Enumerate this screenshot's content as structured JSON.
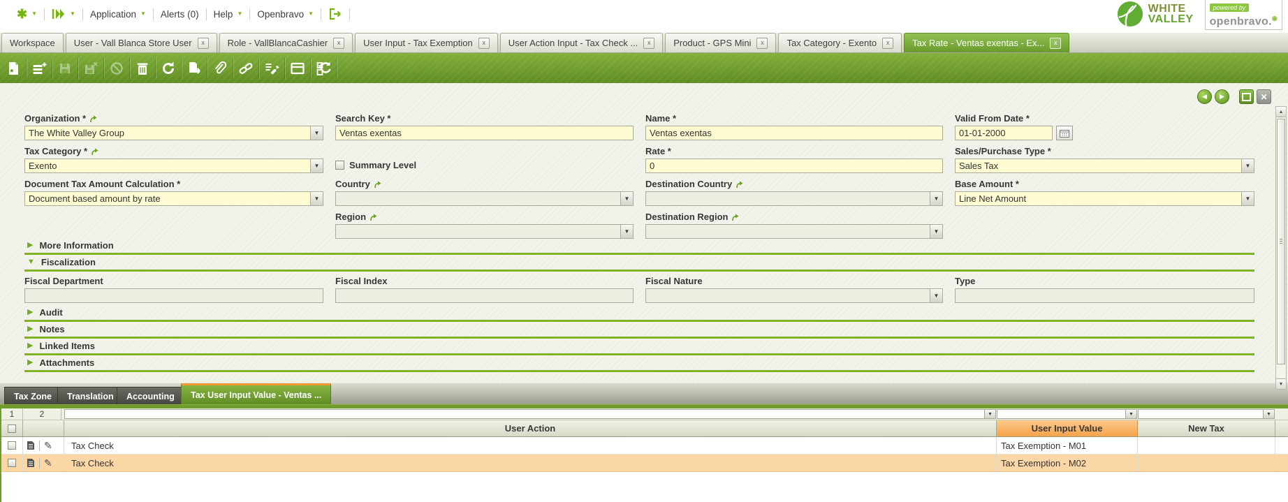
{
  "menubar": {
    "application": "Application",
    "alerts": "Alerts (0)",
    "help": "Help",
    "openbravo": "Openbravo"
  },
  "logo": {
    "line1": "WHITE",
    "line2": "VALLEY"
  },
  "powered_by": {
    "tagline": "powered by",
    "brand": "openbravo."
  },
  "close_glyph": "x",
  "window_tabs": [
    {
      "label": "Workspace",
      "closable": false,
      "active": false
    },
    {
      "label": "User - Vall Blanca Store User",
      "closable": true,
      "active": false
    },
    {
      "label": "Role - VallBlancaCashier",
      "closable": true,
      "active": false
    },
    {
      "label": "User Input - Tax Exemption",
      "closable": true,
      "active": false
    },
    {
      "label": "User Action Input - Tax Check ...",
      "closable": true,
      "active": false
    },
    {
      "label": "Product - GPS Mini",
      "closable": true,
      "active": false
    },
    {
      "label": "Tax Category - Exento",
      "closable": true,
      "active": false
    },
    {
      "label": "Tax Rate - Ventas exentas - Ex...",
      "closable": true,
      "active": true
    }
  ],
  "toolbar": {
    "buttons": [
      {
        "name": "new-record",
        "disabled": false
      },
      {
        "name": "insert-row",
        "disabled": false
      },
      {
        "name": "save",
        "disabled": true
      },
      {
        "name": "save-close",
        "disabled": true
      },
      {
        "name": "undo",
        "disabled": true
      },
      {
        "name": "delete",
        "disabled": false
      },
      {
        "name": "refresh",
        "disabled": false
      },
      {
        "name": "export",
        "disabled": false
      },
      {
        "name": "attachment",
        "disabled": false
      },
      {
        "name": "link",
        "disabled": false
      },
      {
        "name": "tools",
        "disabled": false
      },
      {
        "name": "form-view",
        "disabled": false
      },
      {
        "name": "refresh-grid",
        "disabled": false
      }
    ]
  },
  "colors": {
    "accent_green": "#6f9c2c",
    "active_tab_green": "#699b2c",
    "highlight_orange": "#f6a24a",
    "selected_row": "#fcd7a6",
    "field_yellow": "#fffbd2"
  },
  "form": {
    "fields": {
      "organization": {
        "label": "Organization *",
        "value": "The White Valley Group"
      },
      "search_key": {
        "label": "Search Key *",
        "value": "Ventas exentas"
      },
      "name": {
        "label": "Name *",
        "value": "Ventas exentas"
      },
      "valid_from_date": {
        "label": "Valid From Date *",
        "value": "01-01-2000"
      },
      "tax_category": {
        "label": "Tax Category *",
        "value": "Exento"
      },
      "summary_level": {
        "label": "Summary Level",
        "checked": false
      },
      "rate": {
        "label": "Rate *",
        "value": "0"
      },
      "sales_purchase_type": {
        "label": "Sales/Purchase Type *",
        "value": "Sales Tax"
      },
      "document_tax_amount_calculation": {
        "label": "Document Tax Amount Calculation *",
        "value": "Document based amount by rate"
      },
      "country": {
        "label": "Country",
        "value": ""
      },
      "destination_country": {
        "label": "Destination Country",
        "value": ""
      },
      "base_amount": {
        "label": "Base Amount *",
        "value": "Line Net Amount"
      },
      "region": {
        "label": "Region",
        "value": ""
      },
      "destination_region": {
        "label": "Destination Region",
        "value": ""
      },
      "fiscal_department": {
        "label": "Fiscal Department",
        "value": ""
      },
      "fiscal_index": {
        "label": "Fiscal Index",
        "value": ""
      },
      "fiscal_nature": {
        "label": "Fiscal Nature",
        "value": ""
      },
      "type": {
        "label": "Type",
        "value": ""
      }
    },
    "sections": {
      "more_information": "More Information",
      "fiscalization": "Fiscalization",
      "audit": "Audit",
      "notes": "Notes",
      "linked_items": "Linked Items",
      "attachments": "Attachments"
    }
  },
  "child_tabs": [
    {
      "label": "Tax Zone",
      "active": false
    },
    {
      "label": "Translation",
      "active": false
    },
    {
      "label": "Accounting",
      "active": false
    },
    {
      "label": "Tax User Input Value - Ventas ...",
      "active": true
    }
  ],
  "grid": {
    "pager": [
      "1",
      "2"
    ],
    "columns": {
      "user_action": "User Action",
      "user_input_value": "User Input Value",
      "new_tax": "New Tax"
    },
    "rows": [
      {
        "user_action": "Tax Check",
        "user_input_value": "Tax Exemption - M01",
        "new_tax": "",
        "selected": false
      },
      {
        "user_action": "Tax Check",
        "user_input_value": "Tax Exemption - M02",
        "new_tax": "",
        "selected": true
      }
    ]
  }
}
